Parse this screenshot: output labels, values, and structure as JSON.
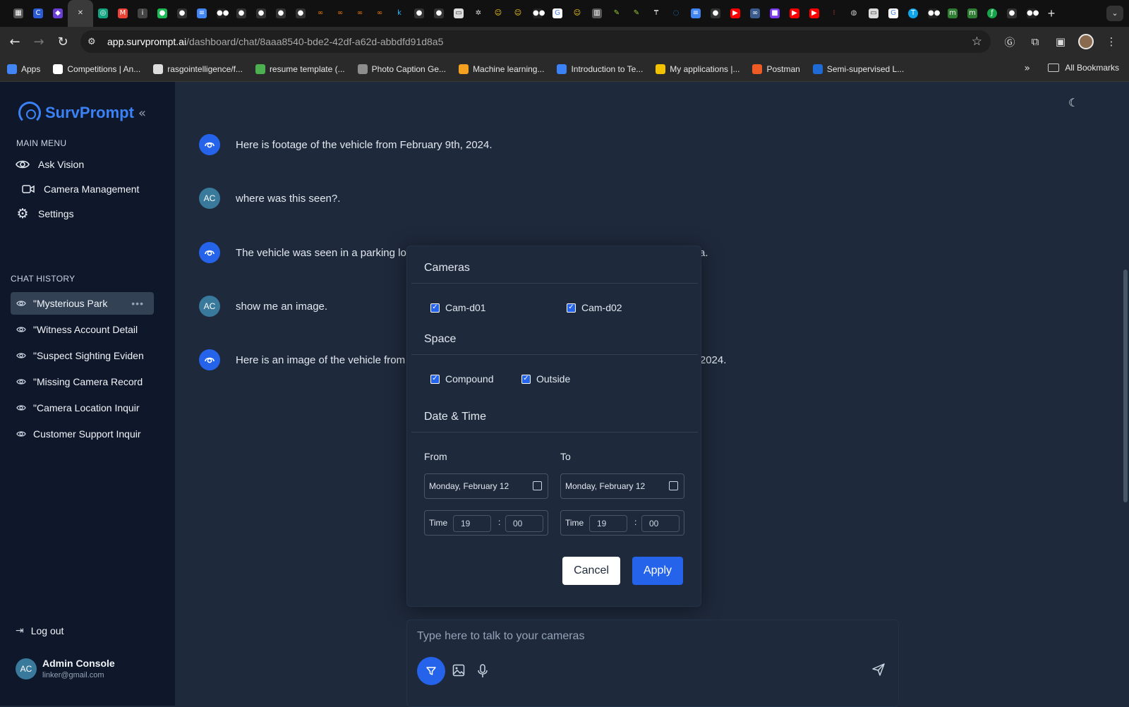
{
  "browser": {
    "url_host": "app.survprompt.ai",
    "url_path": "/dashboard/chat/8aaa8540-bde2-42df-a62d-abbdfd91d8a5",
    "bookmarks": [
      {
        "label": "Apps",
        "color": "#4285f4"
      },
      {
        "label": "Competitions | An...",
        "color": "#ffffff"
      },
      {
        "label": "rasgointelligence/f...",
        "color": "#dddddd"
      },
      {
        "label": "resume template (...",
        "color": "#4caf50"
      },
      {
        "label": "Photo Caption Ge...",
        "color": "#8d8d8d"
      },
      {
        "label": "Machine learning...",
        "color": "#f4a020"
      },
      {
        "label": "Introduction to Te...",
        "color": "#3b82f6"
      },
      {
        "label": "My applications |...",
        "color": "#f2c200"
      },
      {
        "label": "Postman",
        "color": "#ef5b25"
      },
      {
        "label": "Semi-supervised L...",
        "color": "#1e6bd6"
      }
    ],
    "all_bookmarks": "All Bookmarks"
  },
  "sidebar": {
    "brand": "SurvPrompt",
    "main_menu_label": "MAIN MENU",
    "menu": [
      {
        "label": "Ask Vision",
        "icon": "eye-icon"
      },
      {
        "label": "Camera Management",
        "icon": "video-camera-icon"
      },
      {
        "label": "Settings",
        "icon": "gear-icon"
      }
    ],
    "history_label": "CHAT HISTORY",
    "history": [
      {
        "label": "\"Mysterious Park",
        "active": true
      },
      {
        "label": "\"Witness Account Detail",
        "active": false
      },
      {
        "label": "\"Suspect Sighting Eviden",
        "active": false
      },
      {
        "label": "\"Missing Camera Record",
        "active": false
      },
      {
        "label": "\"Camera Location Inquir",
        "active": false
      },
      {
        "label": "Customer Support Inquir",
        "active": false
      }
    ],
    "logout": "Log out",
    "user": {
      "initials": "AC",
      "name": "Admin Console",
      "email": "linker@gmail.com"
    }
  },
  "chat": {
    "messages": [
      {
        "role": "bot",
        "text": "Here is footage of the vehicle from February 9th, 2024."
      },
      {
        "role": "user",
        "initials": "AC",
        "text": "where was this seen?."
      },
      {
        "role": "bot",
        "text": "The vehicle was seen in a parking lot at a compound with the north camera located in Dawaki, Abuja."
      },
      {
        "role": "user",
        "initials": "AC",
        "text": "show me an image."
      },
      {
        "role": "bot",
        "text": "Here is an image of the vehicle from the north camera in the compound, captured on February 9th, 2024."
      }
    ]
  },
  "filter": {
    "cameras_label": "Cameras",
    "cameras": [
      {
        "label": "Cam-d01",
        "checked": true
      },
      {
        "label": "Cam-d02",
        "checked": true
      }
    ],
    "space_label": "Space",
    "spaces": [
      {
        "label": "Compound",
        "checked": true
      },
      {
        "label": "Outside",
        "checked": true
      }
    ],
    "datetime_label": "Date & Time",
    "from_label": "From",
    "to_label": "To",
    "from_date": "Monday, February 12",
    "to_date": "Monday, February 12",
    "time_label": "Time",
    "from_time": {
      "hour": "19",
      "minute": "00"
    },
    "to_time": {
      "hour": "19",
      "minute": "00"
    },
    "cancel": "Cancel",
    "apply": "Apply"
  },
  "composer": {
    "placeholder": "Type here to talk to your cameras"
  },
  "colors": {
    "accent": "#2563eb",
    "background": "#1e293b",
    "sidebar": "#0f172a"
  }
}
